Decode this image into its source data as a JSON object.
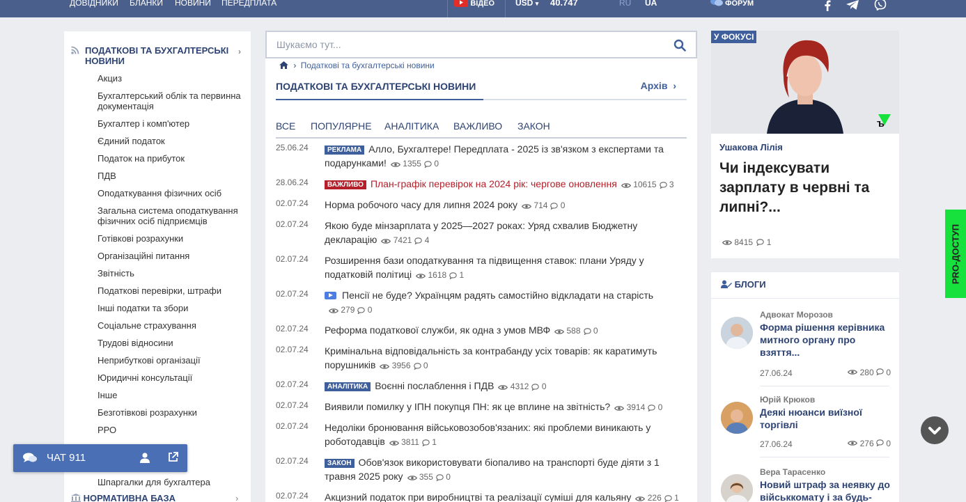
{
  "topbar": {
    "nav": [
      "ДОВІДНИКИ",
      "БЛАНКИ",
      "НОВИНИ",
      "ПЕРЕДПЛАТА"
    ],
    "video_label": "ВІДЕО",
    "currency": "USD",
    "rate": "40.747",
    "lang_ru": "RU",
    "lang_ua": "UA",
    "forum_label": "ФОРУМ",
    "social_icons": [
      "facebook-icon",
      "telegram-icon",
      "viber-icon"
    ]
  },
  "sidebar": {
    "category_title": "ПОДАТКОВІ ТА БУХГАЛТЕРСЬКІ НОВИНИ",
    "items": [
      "Акциз",
      "Бухгалтерський облік та первинна документація",
      "Бухгалтер і комп'ютер",
      "Єдиний податок",
      "Податок на прибуток",
      "ПДВ",
      "Оподаткування фізичних осіб",
      "Загальна система оподаткування фізичних осіб підприємців",
      "Готівкові розрахунки",
      "Організаційні питання",
      "Звітність",
      "Податкові перевірки, штрафи",
      "Інші податки та збори",
      "Соціальне страхування",
      "Трудові відносини",
      "Неприбуткові організації",
      "Юридичні консультації",
      "Інше",
      "Безготівкові розрахунки",
      "РРО",
      "Шпаргалки для бухгалтера"
    ],
    "bottom_category": "НОРМАТИВНА БАЗА"
  },
  "search": {
    "placeholder": "Шукаємо тут..."
  },
  "breadcrumb": {
    "current": "Податкові та бухгалтерські новини"
  },
  "main": {
    "section_title": "ПОДАТКОВІ ТА БУХГАЛТЕРСЬКІ НОВИНИ",
    "archive_label": "Архів",
    "tabs": [
      "ВСЕ",
      "ПОПУЛЯРНЕ",
      "АНАЛІТИКА",
      "ВАЖЛИВО",
      "ЗАКОН"
    ],
    "news": [
      {
        "date": "25.06.24",
        "badge": "РЕКЛАМА",
        "badge_color": "#3f5f9c",
        "title": "Алло, Бухгалтере! Передплата - 2025 із зв'язком з експертами та подарунками!",
        "views": "1355",
        "comments": "0"
      },
      {
        "date": "28.06.24",
        "badge": "ВАЖЛИВО",
        "badge_color": "#b3202a",
        "title": "План-графік перевірок на 2024 рік: чергове оновлення",
        "views": "10615",
        "comments": "3"
      },
      {
        "date": "02.07.24",
        "badge": "",
        "title": "Норма робочого часу для липня 2024 року",
        "views": "714",
        "comments": "0"
      },
      {
        "date": "02.07.24",
        "badge": "",
        "title": "Якою буде мінзарплата у 2025—2027 роках: Уряд схвалив Бюджетну декларацію",
        "views": "7421",
        "comments": "4"
      },
      {
        "date": "02.07.24",
        "badge": "",
        "title": "Розширення бази оподаткування та підвищення ставок: плани Уряду у податковій політиці",
        "views": "1618",
        "comments": "1"
      },
      {
        "date": "02.07.24",
        "badge": "",
        "video": true,
        "title": "Пенсії не буде? Українцям радять самостійно відкладати на старість",
        "views": "279",
        "comments": "0"
      },
      {
        "date": "02.07.24",
        "badge": "",
        "title": "Реформа податкової служби, як одна з умов МВФ",
        "views": "588",
        "comments": "0"
      },
      {
        "date": "02.07.24",
        "badge": "",
        "title": "Кримінальна відповідальність за контрабанду усіх товарів: як каратимуть порушників",
        "views": "3956",
        "comments": "0"
      },
      {
        "date": "02.07.24",
        "badge": "АНАЛІТИКА",
        "badge_color": "#3f5f9c",
        "title": "Воєнні послаблення і ПДВ",
        "views": "4312",
        "comments": "0"
      },
      {
        "date": "02.07.24",
        "badge": "",
        "title": "Виявили помилку у ІПН покупця ПН: як це вплине на звітність?",
        "views": "3914",
        "comments": "0"
      },
      {
        "date": "02.07.24",
        "badge": "",
        "title": "Недоліки бронювання військовозобов'язаних: які проблеми виникають у роботодавців",
        "views": "3811",
        "comments": "1"
      },
      {
        "date": "02.07.24",
        "badge": "ЗАКОН",
        "badge_color": "#3f5f9c",
        "title": "Обов'язок використовувати біопаливо на транспорті буде діяти з 1 травня 2025 року",
        "views": "355",
        "comments": "0"
      },
      {
        "date": "02.07.24",
        "badge": "",
        "title": "Акцизний податок при виробництві та реалізації суміші для кальяну",
        "views": "226",
        "comments": "1"
      }
    ]
  },
  "focus": {
    "label": "У ФОКУСІ",
    "author": "Ушакова Лілія",
    "title": "Чи індексувати зарплату в червні та липні?...",
    "views": "8415",
    "comments": "1"
  },
  "blogs": {
    "header": "БЛОГИ",
    "items": [
      {
        "author": "Адвокат Морозов",
        "title": "Форма рішення керівника митного органу про взяття...",
        "date": "27.06.24",
        "views": "280",
        "comments": "0"
      },
      {
        "author": "Юрій Крюков",
        "title": "Деякі нюанси виїзної торгівлі",
        "date": "27.06.24",
        "views": "276",
        "comments": "0"
      },
      {
        "author": "Вера Тарасенко",
        "title": "Новий штраф за неявку до військкомату і за будь-",
        "date": "",
        "views": "",
        "comments": ""
      }
    ]
  },
  "pro_access_label": "PRO-ДОСТУП",
  "chat": {
    "label": "ЧАТ 911"
  }
}
